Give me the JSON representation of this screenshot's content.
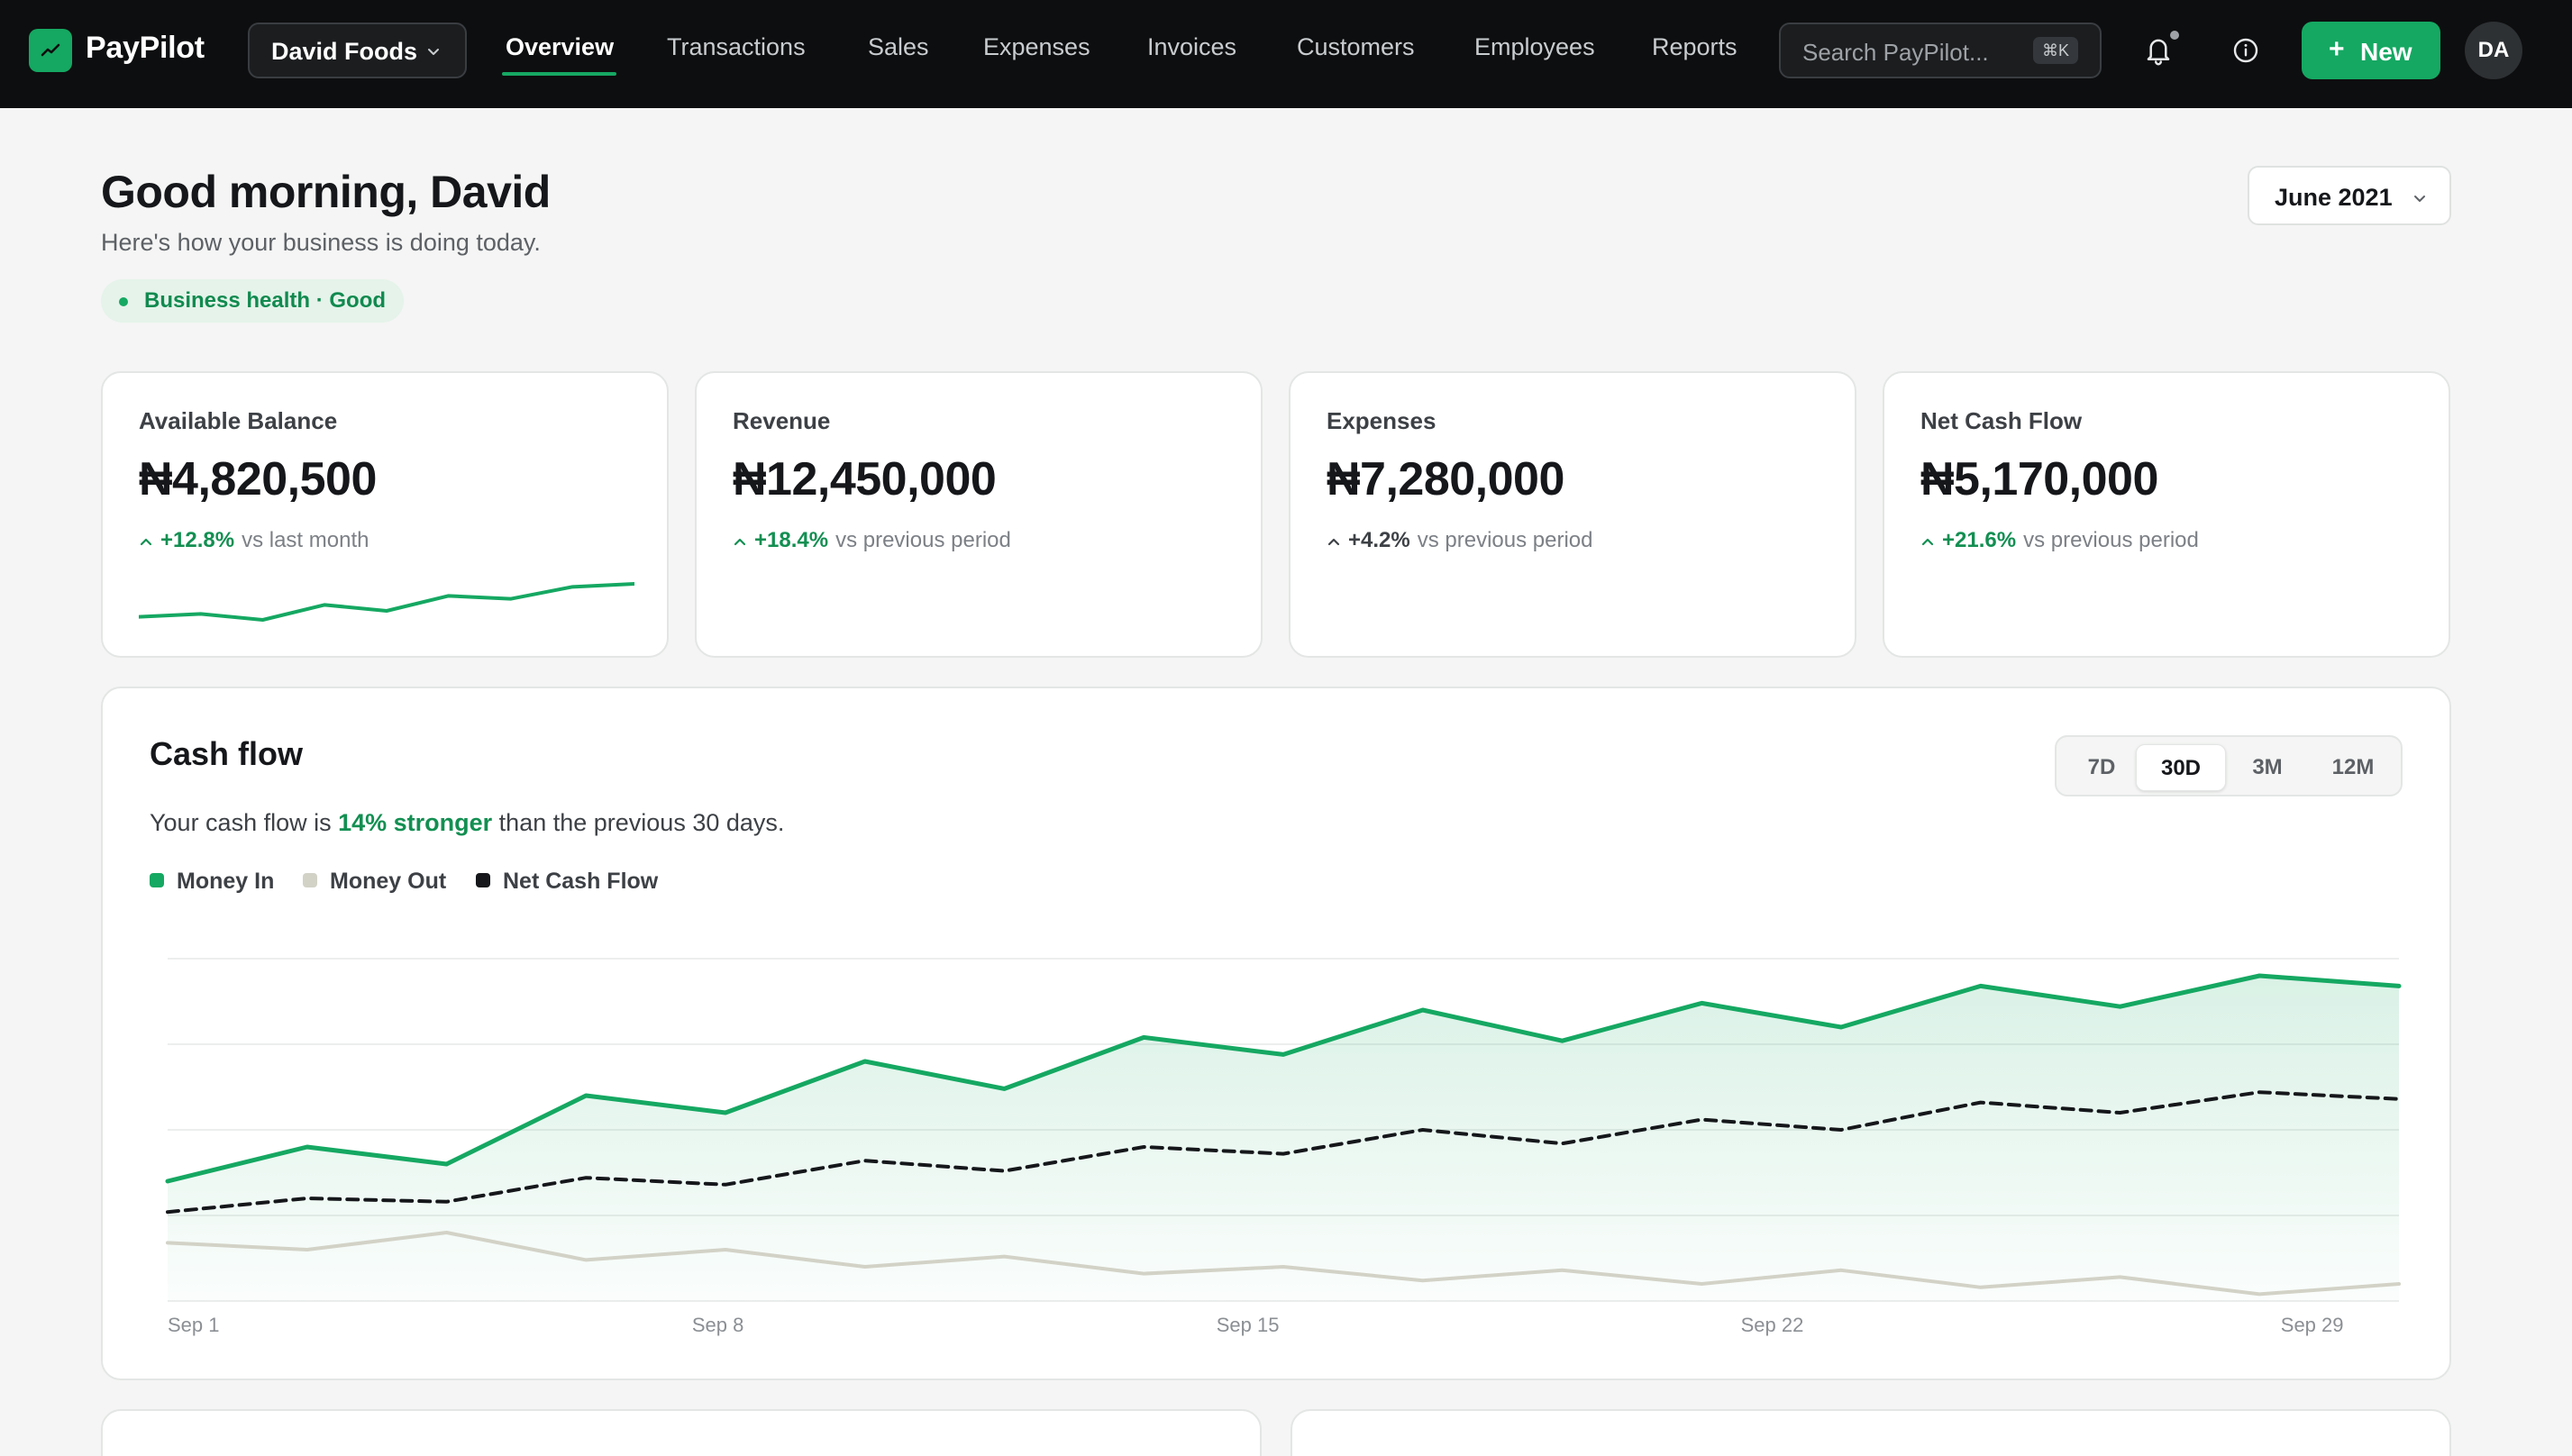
{
  "app": {
    "name": "PayPilot",
    "company": "David Foods",
    "nav": [
      "Overview",
      "Transactions",
      "Sales",
      "Expenses",
      "Invoices",
      "Customers",
      "Employees",
      "Reports"
    ],
    "active_nav": "Overview",
    "search_placeholder": "Search PayPilot...",
    "search_shortcut": "⌘K",
    "new_button": "New",
    "new_button_icon": "+",
    "avatar_initials": "DA",
    "icons": [
      "logo-trend-icon",
      "chevron-down-icon",
      "bell-icon",
      "info-icon",
      "plus-icon"
    ]
  },
  "header": {
    "greeting": "Good morning, David",
    "subtitle": "Here's how your business is doing today.",
    "health_badge": "Business health · Good",
    "period": "June 2021"
  },
  "kpis": [
    {
      "title": "Available Balance",
      "value": "₦4,820,500",
      "change": "+12.8%",
      "comparison": "vs last month",
      "trend": "up",
      "sparkline": [
        2,
        3,
        1,
        6,
        4,
        9,
        8,
        12,
        13
      ]
    },
    {
      "title": "Revenue",
      "value": "₦12,450,000",
      "change": "+18.4%",
      "comparison": "vs previous period",
      "trend": "up"
    },
    {
      "title": "Expenses",
      "value": "₦7,280,000",
      "change": "+4.2%",
      "comparison": "vs previous period",
      "trend": "up"
    },
    {
      "title": "Net Cash Flow",
      "value": "₦5,170,000",
      "change": "+21.6%",
      "comparison": "vs previous period",
      "trend": "up"
    }
  ],
  "cashflow": {
    "title": "Cash flow",
    "desc_before": "Your cash flow is ",
    "desc_highlight": "14% stronger",
    "desc_after": " than the previous 30 days.",
    "ranges": [
      "7D",
      "30D",
      "3M",
      "12M"
    ],
    "active_range": "30D",
    "legend": [
      {
        "name": "Money In",
        "color": "#15a862"
      },
      {
        "name": "Money Out",
        "color": "#d3d2c7"
      },
      {
        "name": "Net Cash Flow",
        "color": "#15171a"
      }
    ]
  },
  "colors": {
    "accent": "#15a862",
    "positive": "#138f52",
    "money_out": "#d3d2c7",
    "net": "#15171a"
  },
  "chart_data": {
    "type": "line",
    "title": "Cash flow",
    "x": [
      "Sep 1",
      "Sep 3",
      "Sep 5",
      "Sep 7",
      "Sep 9",
      "Sep 11",
      "Sep 13",
      "Sep 15",
      "Sep 17",
      "Sep 19",
      "Sep 21",
      "Sep 23",
      "Sep 25",
      "Sep 27",
      "Sep 29",
      "Sep 30"
    ],
    "x_tick_labels": [
      "Sep 1",
      "Sep 8",
      "Sep 15",
      "Sep 22",
      "Sep 29"
    ],
    "series": [
      {
        "name": "Money In",
        "values": [
          35,
          45,
          40,
          60,
          55,
          70,
          62,
          77,
          72,
          85,
          76,
          87,
          80,
          92,
          86,
          95,
          92
        ],
        "fill": true
      },
      {
        "name": "Money Out",
        "values": [
          17,
          15,
          20,
          12,
          15,
          10,
          13,
          8,
          10,
          6,
          9,
          5,
          9,
          4,
          7,
          2,
          5
        ]
      },
      {
        "name": "Net Cash Flow",
        "values": [
          26,
          30,
          29,
          36,
          34,
          41,
          38,
          45,
          43,
          50,
          46,
          53,
          50,
          58,
          55,
          61,
          59
        ],
        "style": "dashed"
      }
    ],
    "ylim": [
      0,
      100
    ],
    "grid": true,
    "y_tick_labels_visible": false
  }
}
